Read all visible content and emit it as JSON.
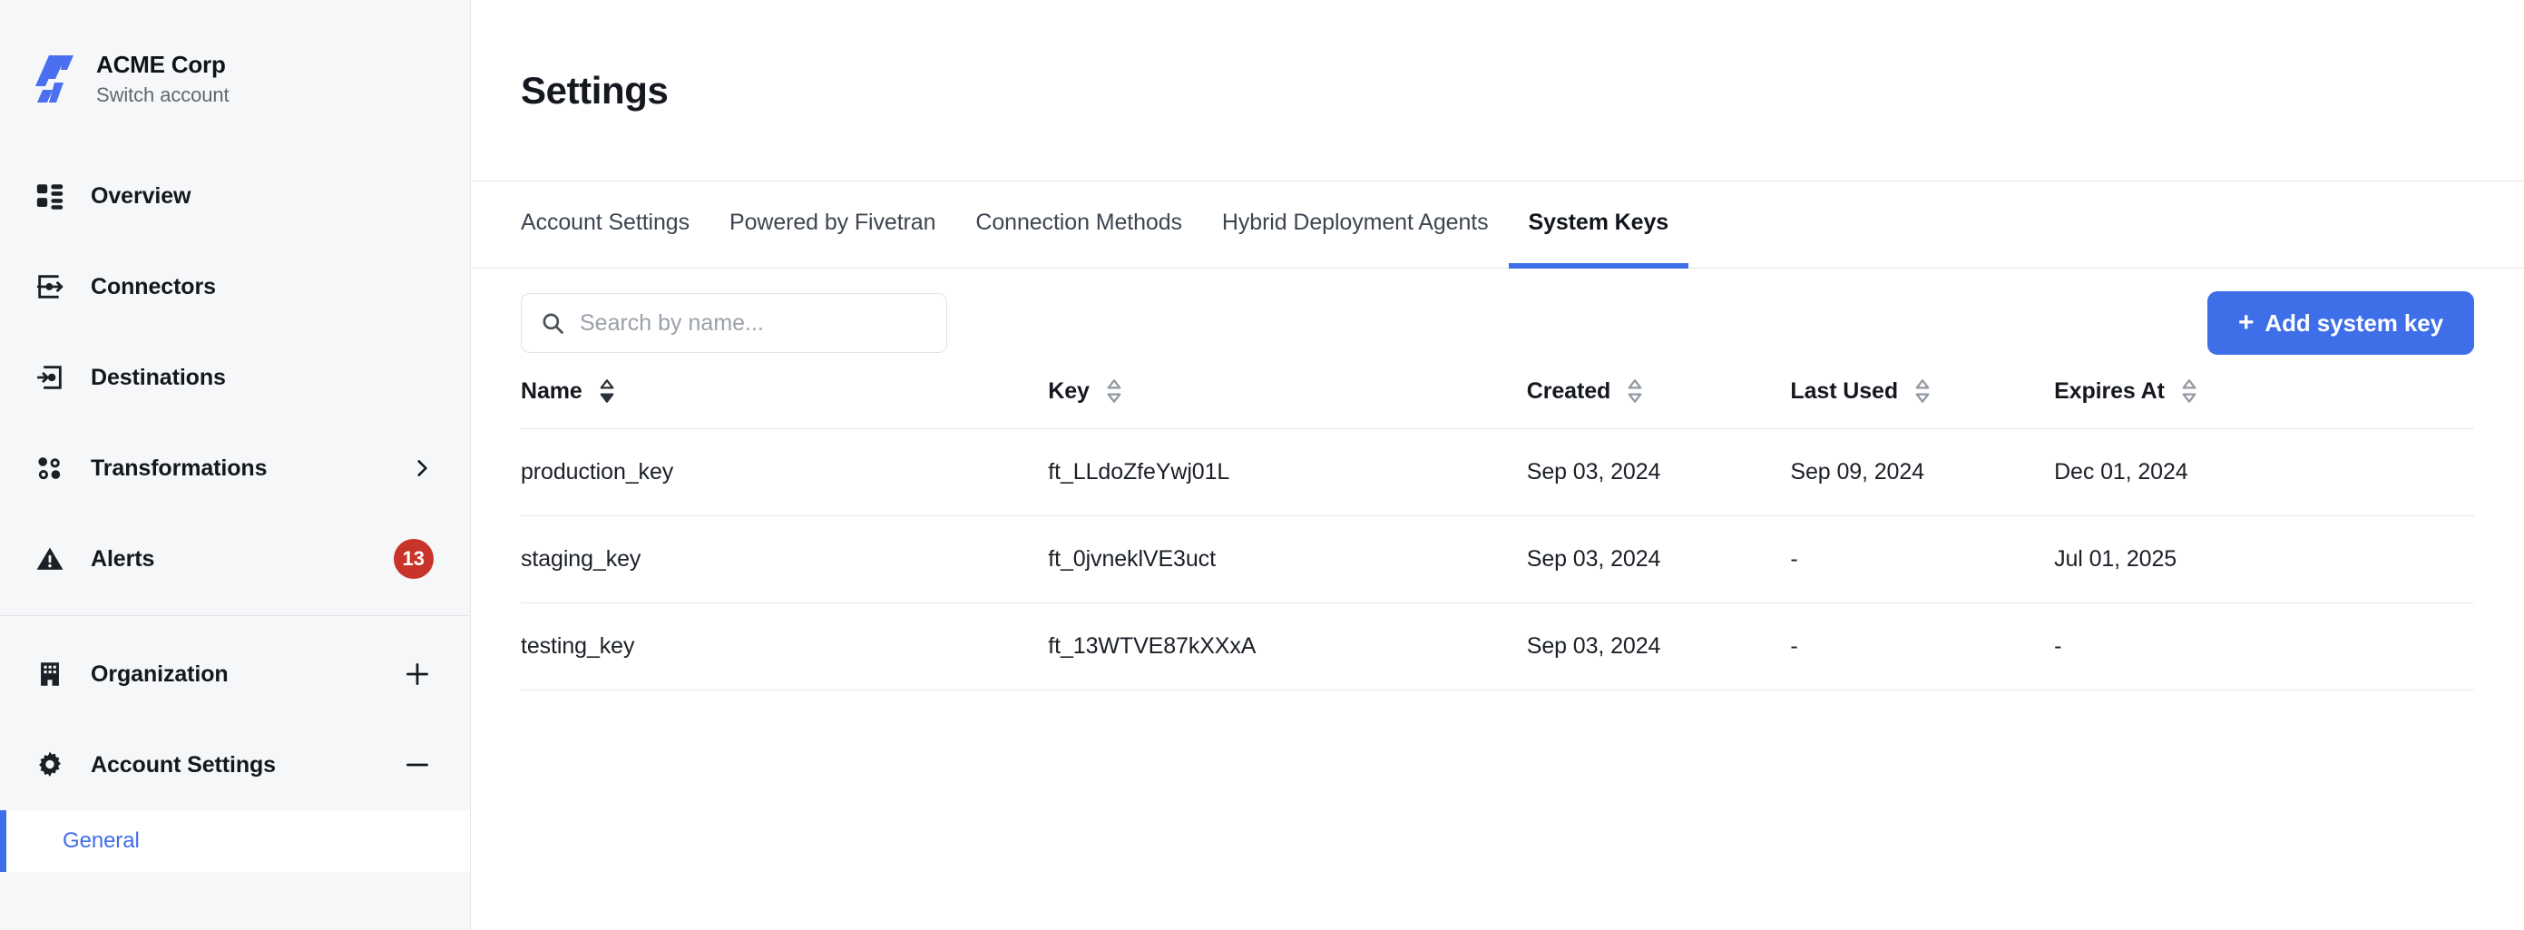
{
  "sidebar": {
    "brand": {
      "name": "ACME Corp",
      "switch_label": "Switch account",
      "logo_color": "#4a6ff0"
    },
    "items": [
      {
        "label": "Overview",
        "icon": "dashboard-icon",
        "badge": null,
        "control": null
      },
      {
        "label": "Connectors",
        "icon": "connectors-icon",
        "badge": null,
        "control": null
      },
      {
        "label": "Destinations",
        "icon": "destinations-icon",
        "badge": null,
        "control": null
      },
      {
        "label": "Transformations",
        "icon": "transformations-icon",
        "badge": null,
        "control": "chevron-right"
      },
      {
        "label": "Alerts",
        "icon": "alert-triangle-icon",
        "badge": "13",
        "control": null
      },
      {
        "label": "Organization",
        "icon": "building-icon",
        "badge": null,
        "control": "plus"
      },
      {
        "label": "Account Settings",
        "icon": "gear-icon",
        "badge": null,
        "control": "minus"
      }
    ],
    "sub_items": [
      {
        "label": "General",
        "active": true
      }
    ],
    "badge_color": "#c8342a",
    "active_color": "#3f6fe8"
  },
  "header": {
    "title": "Settings"
  },
  "tabs": [
    {
      "label": "Account Settings",
      "active": false
    },
    {
      "label": "Powered by Fivetran",
      "active": false
    },
    {
      "label": "Connection Methods",
      "active": false
    },
    {
      "label": "Hybrid Deployment Agents",
      "active": false
    },
    {
      "label": "System Keys",
      "active": true
    }
  ],
  "toolbar": {
    "search_placeholder": "Search by name...",
    "search_value": "",
    "search_icon": "search-icon",
    "add_key_label": "Add system key",
    "add_key_plus": "+",
    "accent_color": "#3f6fe8"
  },
  "table": {
    "columns": [
      {
        "label": "Name",
        "sortable": true,
        "sort_state": "active"
      },
      {
        "label": "Key",
        "sortable": true,
        "sort_state": "inactive"
      },
      {
        "label": "Created",
        "sortable": true,
        "sort_state": "inactive"
      },
      {
        "label": "Last Used",
        "sortable": true,
        "sort_state": "inactive"
      },
      {
        "label": "Expires At",
        "sortable": true,
        "sort_state": "inactive"
      }
    ],
    "rows": [
      {
        "name": "production_key",
        "key": "ft_LLdoZfeYwj01L",
        "created": "Sep 03, 2024",
        "last_used": "Sep 09, 2024",
        "expires_at": "Dec 01, 2024"
      },
      {
        "name": "staging_key",
        "key": "ft_0jvneklVE3uct",
        "created": "Sep 03, 2024",
        "last_used": "-",
        "expires_at": "Jul 01, 2025"
      },
      {
        "name": "testing_key",
        "key": "ft_13WTVE87kXXxA",
        "created": "Sep 03, 2024",
        "last_used": "-",
        "expires_at": "-"
      }
    ]
  }
}
